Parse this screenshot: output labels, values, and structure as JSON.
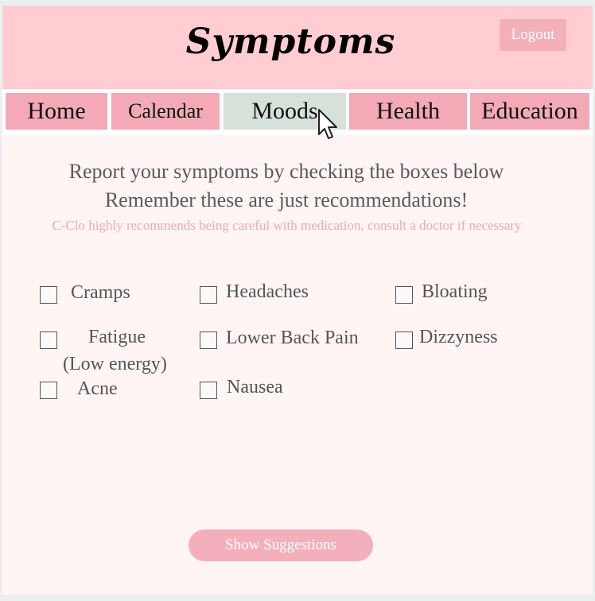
{
  "header": {
    "title": "Symptoms",
    "logout_label": "Logout"
  },
  "nav": {
    "tabs": [
      {
        "label": "Home"
      },
      {
        "label": "Calendar"
      },
      {
        "label": "Moods",
        "active": true
      },
      {
        "label": "Health"
      },
      {
        "label": "Education"
      }
    ]
  },
  "intro": {
    "line1": "Report your symptoms by checking the boxes below",
    "line2": "Remember these are just recommendations!",
    "disclaimer": "C-Clo highly recommends being careful with medication, consult a doctor if necessary"
  },
  "symptoms": {
    "cramps": "Cramps",
    "headaches": "Headaches",
    "bloating": "Bloating",
    "fatigue_line1": "Fatigue",
    "fatigue_line2": "(Low energy)",
    "lower_back_pain": "Lower Back Pain",
    "dizzyness": "Dizzyness",
    "acne": "Acne",
    "nausea": "Nausea"
  },
  "actions": {
    "show_suggestions": "Show Suggestions"
  },
  "colors": {
    "header_bg": "#ffcdd2",
    "tab_bg": "#f3aab6",
    "active_tab_bg": "#d6e1da",
    "page_bg": "#fff5f5",
    "button_bg": "#f3b0bc",
    "disclaimer_text": "#f0a8b4"
  }
}
